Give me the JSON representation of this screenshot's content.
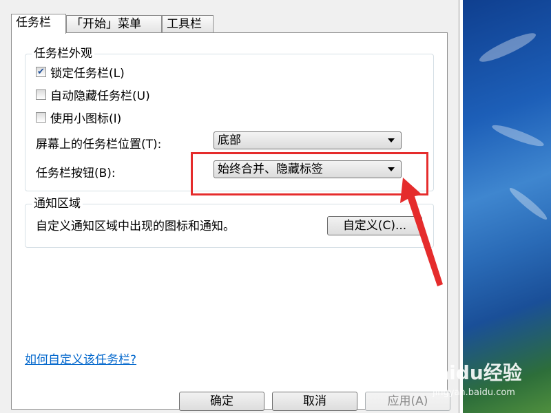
{
  "tabs": [
    {
      "label": "任务栏"
    },
    {
      "label": "「开始」菜单"
    },
    {
      "label": "工具栏"
    }
  ],
  "appearance": {
    "title": "任务栏外观",
    "checkboxes": [
      {
        "label": "锁定任务栏(L)",
        "checked": true
      },
      {
        "label": "自动隐藏任务栏(U)",
        "checked": false
      },
      {
        "label": "使用小图标(I)",
        "checked": false
      }
    ],
    "position_label": "屏幕上的任务栏位置(T):",
    "position_value": "底部",
    "buttons_label": "任务栏按钮(B):",
    "buttons_value": "始终合并、隐藏标签"
  },
  "notification": {
    "title": "通知区域",
    "description": "自定义通知区域中出现的图标和通知。",
    "customize_button": "自定义(C)..."
  },
  "help_link": "如何自定义该任务栏?",
  "footer": {
    "ok": "确定",
    "cancel": "取消",
    "apply": "应用(A)"
  },
  "watermark": {
    "brand": "Baidu经验",
    "url": "jingyan.baidu.com"
  },
  "colors": {
    "highlight": "#e52c2c",
    "link": "#0066cc"
  }
}
